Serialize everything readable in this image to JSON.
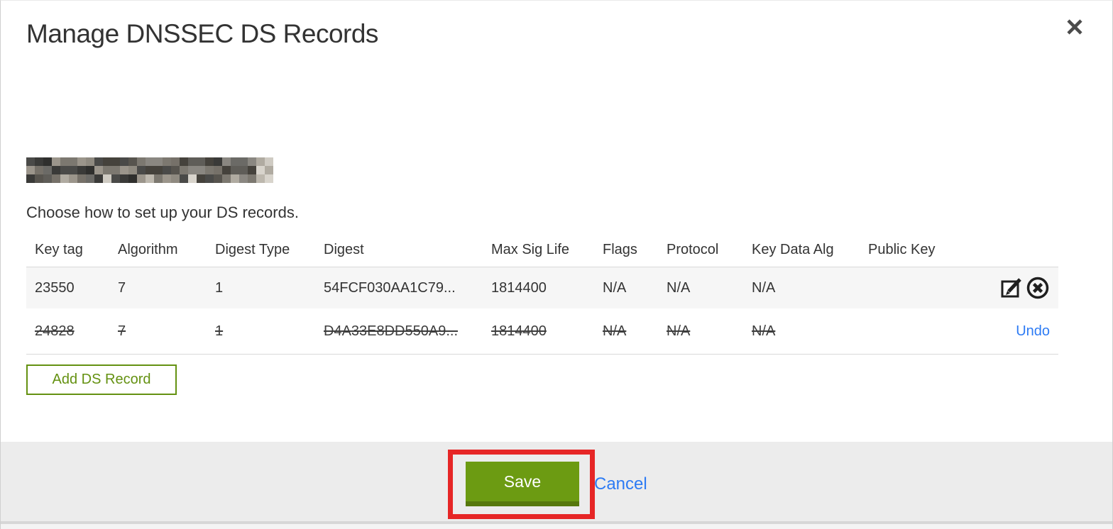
{
  "modal": {
    "title": "Manage DNSSEC DS Records",
    "instruction": "Choose how to set up your DS records.",
    "table": {
      "headers": [
        "Key tag",
        "Algorithm",
        "Digest Type",
        "Digest",
        "Max Sig Life",
        "Flags",
        "Protocol",
        "Key Data Alg",
        "Public Key"
      ],
      "rows": [
        {
          "key_tag": "23550",
          "algorithm": "7",
          "digest_type": "1",
          "digest": "54FCF030AA1C79...",
          "max_sig_life": "1814400",
          "flags": "N/A",
          "protocol": "N/A",
          "key_data_alg": "N/A",
          "public_key": "",
          "state": "normal"
        },
        {
          "key_tag": "24828",
          "algorithm": "7",
          "digest_type": "1",
          "digest": "D4A33E8DD550A9...",
          "max_sig_life": "1814400",
          "flags": "N/A",
          "protocol": "N/A",
          "key_data_alg": "N/A",
          "public_key": "",
          "state": "deleted",
          "undo_label": "Undo"
        }
      ]
    },
    "add_button_label": "Add DS Record",
    "footer": {
      "save_label": "Save",
      "cancel_label": "Cancel"
    },
    "colors": {
      "button_green": "#6c9b12",
      "button_green_dark": "#56780c",
      "outline_green": "#649111",
      "link_blue": "#2d7bf4",
      "annotation_red": "#e62626",
      "footer_bg": "#ececec",
      "row_shaded_bg": "#f6f6f6",
      "table_border": "#d9d9d9",
      "text": "#333333"
    }
  }
}
